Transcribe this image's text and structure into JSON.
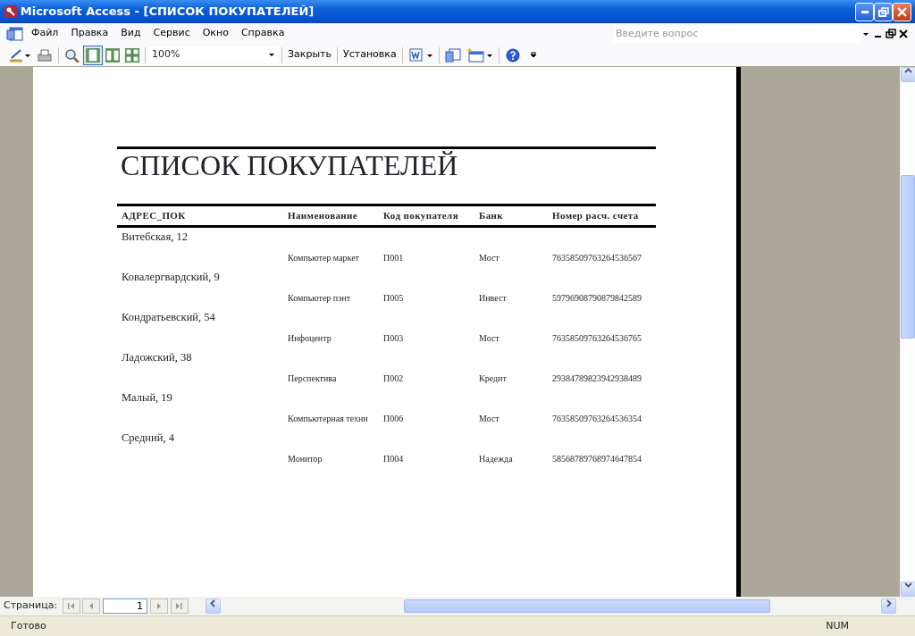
{
  "window": {
    "title": "Microsoft Access - [СПИСОК ПОКУПАТЕЛЕЙ]"
  },
  "menu": [
    "Файл",
    "Правка",
    "Вид",
    "Сервис",
    "Окно",
    "Справка"
  ],
  "help_search": {
    "placeholder": "Введите вопрос"
  },
  "toolbar": {
    "view_buttons": [
      {
        "kind": "one-page",
        "selected": true
      },
      {
        "kind": "two-pages",
        "selected": false
      },
      {
        "kind": "multiple-pages",
        "selected": false
      }
    ],
    "zoom": "100%",
    "buttons": [
      "Закрыть",
      "Установка"
    ]
  },
  "report": {
    "title": "СПИСОК ПОКУПАТЕЛЕЙ",
    "columns": [
      "АДРЕС_ПОК",
      "Наименование",
      "Код покупателя",
      "Банк",
      "Номер расч. счета"
    ],
    "groups": [
      {
        "address": "Витебская, 12",
        "rows": [
          {
            "name": "Компьютер маркет",
            "code": "П001",
            "bank": "Мост",
            "account": "76358509763264536567"
          }
        ]
      },
      {
        "address": "Ковалергвардский, 9",
        "rows": [
          {
            "name": "Компьютер пэнт",
            "code": "П005",
            "bank": "Инвест",
            "account": "59796908790879842589"
          }
        ]
      },
      {
        "address": "Кондратьевский, 54",
        "rows": [
          {
            "name": "Инфоцентр",
            "code": "П003",
            "bank": "Мост",
            "account": "76358509763264536765"
          }
        ]
      },
      {
        "address": "Ладожский, 38",
        "rows": [
          {
            "name": "Перспектива",
            "code": "П002",
            "bank": "Кредит",
            "account": "29384789823942938489"
          }
        ]
      },
      {
        "address": "Малый, 19",
        "rows": [
          {
            "name": "Компьютерная техни",
            "code": "П006",
            "bank": "Мост",
            "account": "76358509763264536354"
          }
        ]
      },
      {
        "address": "Средний, 4",
        "rows": [
          {
            "name": "Монитор",
            "code": "П004",
            "bank": "Надежда",
            "account": "58568789768974647854"
          }
        ]
      }
    ]
  },
  "navigation": {
    "label": "Страница:",
    "page": "1"
  },
  "status_bar": {
    "text": "Готово",
    "indicators": [
      "NUM"
    ]
  }
}
